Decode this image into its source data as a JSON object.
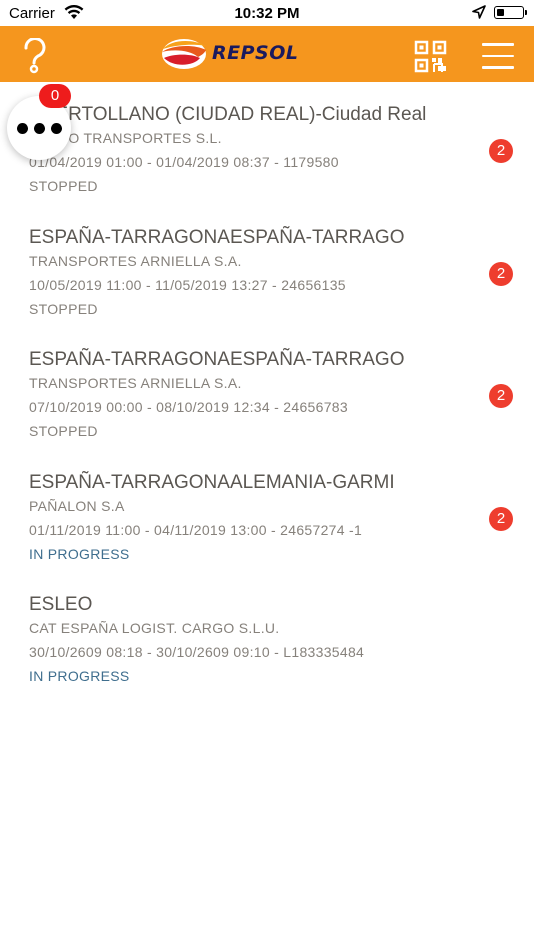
{
  "status_bar": {
    "carrier": "Carrier",
    "time": "10:32 PM",
    "battery_level": 0.3
  },
  "header": {
    "logo_text": "REPSOL",
    "help_icon": "question-mark-icon",
    "qr_icon": "qr-code-icon",
    "menu_icon": "hamburger-menu-icon",
    "background_color": "#f5961e"
  },
  "floating_button": {
    "icon": "more-options-icon",
    "badge": "0"
  },
  "trips": [
    {
      "title": "PUERTOLLANO (CIUDAD REAL)-Ciudad Real",
      "company": "DEXPO TRANSPORTES S.L.",
      "dates": "01/04/2019 01:00 - 01/04/2019 08:37 - 1179580",
      "status": "STOPPED",
      "badge": "2"
    },
    {
      "title": "ESPAÑA-TARRAGONAESPAÑA-TARRAGO",
      "company": "TRANSPORTES ARNIELLA S.A.",
      "dates": "10/05/2019 11:00 - 11/05/2019 13:27 - 24656135",
      "status": "STOPPED",
      "badge": "2"
    },
    {
      "title": "ESPAÑA-TARRAGONAESPAÑA-TARRAGO",
      "company": "TRANSPORTES ARNIELLA S.A.",
      "dates": "07/10/2019 00:00 - 08/10/2019 12:34 - 24656783",
      "status": "STOPPED",
      "badge": "2"
    },
    {
      "title": "ESPAÑA-TARRAGONAALEMANIA-GARMI",
      "company": "PAÑALON S.A",
      "dates": "01/11/2019 11:00 - 04/11/2019 13:00 - 24657274 -1",
      "status": "IN PROGRESS",
      "badge": "2"
    },
    {
      "title": "ESLEO",
      "company": "CAT ESPAÑA LOGIST. CARGO S.L.U.",
      "dates": "30/10/2609 08:18 - 30/10/2609 09:10 - L183335484",
      "status": "IN PROGRESS",
      "badge": ""
    }
  ]
}
